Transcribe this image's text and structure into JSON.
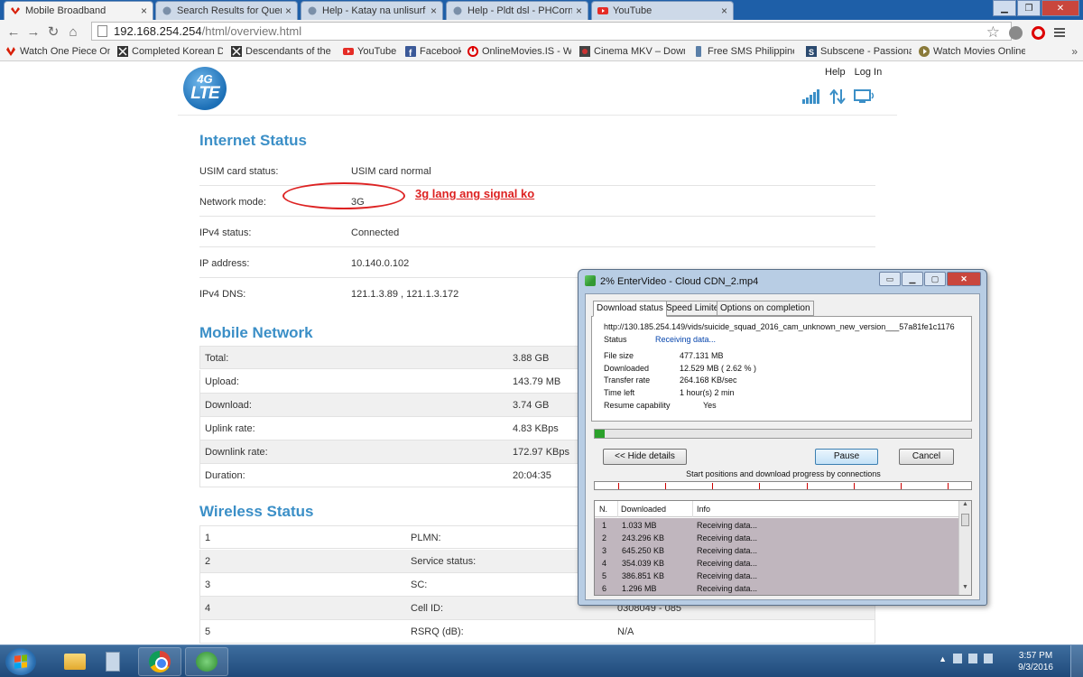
{
  "browser": {
    "tabs": [
      {
        "title": "Mobile Broadband",
        "active": true
      },
      {
        "title": "Search Results for Query:",
        "active": false
      },
      {
        "title": "Help - Katay na unlisurf",
        "active": false
      },
      {
        "title": "Help - Pldt dsl - PHCorner",
        "active": false
      },
      {
        "title": "YouTube",
        "active": false
      }
    ],
    "url_host": "192.168.254.254",
    "url_path": "/html/overview.html",
    "bookmarks": [
      {
        "label": "Watch One Piece Online",
        "icon": "huawei-icon"
      },
      {
        "label": "Completed Korean Dram",
        "icon": "site-icon"
      },
      {
        "label": "Descendants of the Sun",
        "icon": "site-icon"
      },
      {
        "label": "YouTube",
        "icon": "youtube-icon"
      },
      {
        "label": "Facebook",
        "icon": "facebook-icon"
      },
      {
        "label": "OnlineMovies.IS - Watch",
        "icon": "power-icon"
      },
      {
        "label": "Cinema MKV – Down",
        "icon": "site-icon"
      },
      {
        "label": "Free SMS Philippines",
        "icon": "phone-icon"
      },
      {
        "label": "Subscene - Passionat",
        "icon": "subscene-icon"
      },
      {
        "label": "Watch Movies Online",
        "icon": "play-icon"
      }
    ],
    "bookmarks_more": "»"
  },
  "router": {
    "logo_top": "4G",
    "logo_bottom": "LTE",
    "header_links": {
      "help": "Help",
      "login": "Log In"
    },
    "internet_status": {
      "title": "Internet Status",
      "rows": [
        {
          "key": "USIM card status:",
          "value": "USIM card normal"
        },
        {
          "key": "Network mode:",
          "value": "3G"
        },
        {
          "key": "IPv4 status:",
          "value": "Connected"
        },
        {
          "key": "IP address:",
          "value": "10.140.0.102"
        },
        {
          "key": "IPv4 DNS:",
          "value": "121.1.3.89 , 121.1.3.172"
        }
      ]
    },
    "annotation": "3g lang ang signal ko",
    "mobile_network": {
      "title": "Mobile Network",
      "rows": [
        {
          "key": "Total:",
          "value": "3.88 GB"
        },
        {
          "key": "Upload:",
          "value": "143.79 MB"
        },
        {
          "key": "Download:",
          "value": "3.74 GB"
        },
        {
          "key": "Uplink rate:",
          "value": "4.83 KBps"
        },
        {
          "key": "Downlink rate:",
          "value": "172.97 KBps"
        },
        {
          "key": "Duration:",
          "value": "20:04:35"
        }
      ]
    },
    "wireless_status": {
      "title": "Wireless Status",
      "rows": [
        {
          "num": "1",
          "key": "PLMN:",
          "value": ""
        },
        {
          "num": "2",
          "key": "Service status:",
          "value": ""
        },
        {
          "num": "3",
          "key": "SC:",
          "value": ""
        },
        {
          "num": "4",
          "key": "Cell ID:",
          "value": "0308049 - 085"
        },
        {
          "num": "5",
          "key": "RSRQ (dB):",
          "value": "N/A"
        }
      ]
    }
  },
  "dialog": {
    "title": "2% EnterVideo - Cloud CDN_2.mp4",
    "tabs": [
      "Download status",
      "Speed Limiter",
      "Options on completion"
    ],
    "url": "http://130.185.254.149/vids/suicide_squad_2016_cam_unknown_new_version___57a81fe1c1176",
    "status_label": "Status",
    "status_value": "Receiving data...",
    "details": [
      {
        "label": "File size",
        "value": "477.131  MB"
      },
      {
        "label": "Downloaded",
        "value": "12.529  MB  ( 2.62 % )"
      },
      {
        "label": "Transfer rate",
        "value": "264.168  KB/sec"
      },
      {
        "label": "Time left",
        "value": "1 hour(s) 2 min"
      },
      {
        "label": "Resume capability",
        "value": "Yes"
      }
    ],
    "progress_percent": 2.62,
    "hide_details_label": "<< Hide details",
    "pause_label": "Pause",
    "cancel_label": "Cancel",
    "connections_caption": "Start positions and download progress by connections",
    "connection_marks": 8,
    "list_headers": {
      "n": "N.",
      "downloaded": "Downloaded",
      "info": "Info"
    },
    "connections": [
      {
        "n": "1",
        "downloaded": "1.033  MB",
        "info": "Receiving data..."
      },
      {
        "n": "2",
        "downloaded": "243.296  KB",
        "info": "Receiving data..."
      },
      {
        "n": "3",
        "downloaded": "645.250  KB",
        "info": "Receiving data..."
      },
      {
        "n": "4",
        "downloaded": "354.039  KB",
        "info": "Receiving data..."
      },
      {
        "n": "5",
        "downloaded": "386.851  KB",
        "info": "Receiving data..."
      },
      {
        "n": "6",
        "downloaded": "1.296  MB",
        "info": "Receiving data..."
      }
    ]
  },
  "taskbar": {
    "time": "3:57 PM",
    "date": "9/3/2016"
  },
  "colors": {
    "accent": "#3b8fc7",
    "annotation": "#dd2222",
    "progress": "#2aa12a"
  }
}
